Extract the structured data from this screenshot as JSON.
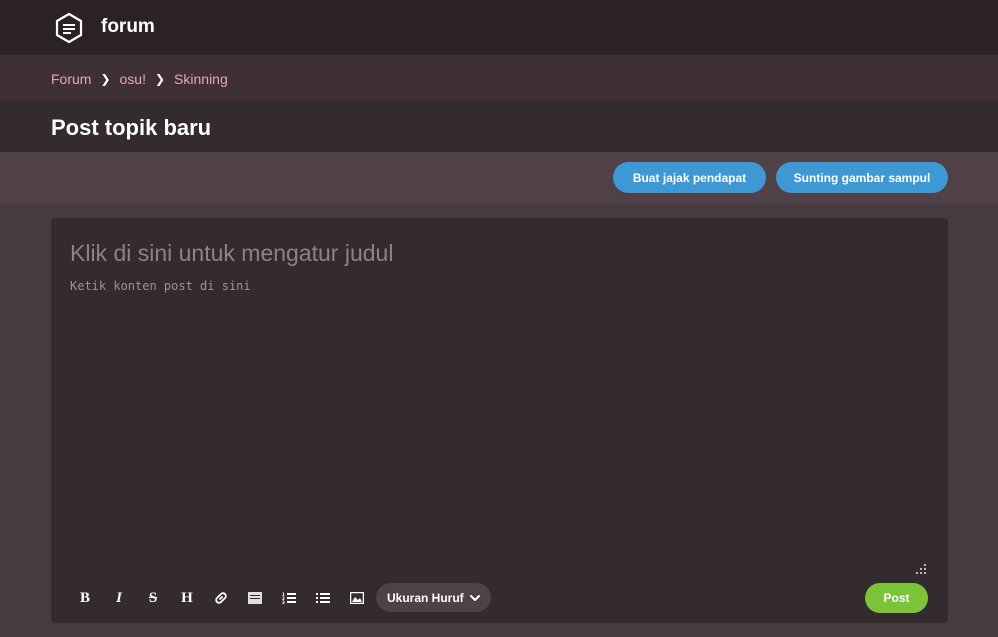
{
  "header": {
    "brand": "forum",
    "logo_icon": "forum-logo-icon"
  },
  "breadcrumb": {
    "items": [
      "Forum",
      "osu!",
      "Skinning"
    ]
  },
  "page": {
    "title": "Post topik baru"
  },
  "actions": {
    "poll_label": "Buat jajak pendapat",
    "cover_label": "Sunting gambar sampul"
  },
  "editor": {
    "title_placeholder": "Klik di sini untuk mengatur judul",
    "content_placeholder": "Ketik konten post di sini",
    "toolbar": {
      "bold": "B",
      "italic": "I",
      "strike": "S",
      "heading": "H",
      "font_size_label": "Ukuran Huruf"
    },
    "post_label": "Post"
  },
  "colors": {
    "accent_blue": "#3d98d4",
    "post_green": "#7bc43a",
    "breadcrumb_pink": "#e8a5c0",
    "background": "#463b40"
  }
}
